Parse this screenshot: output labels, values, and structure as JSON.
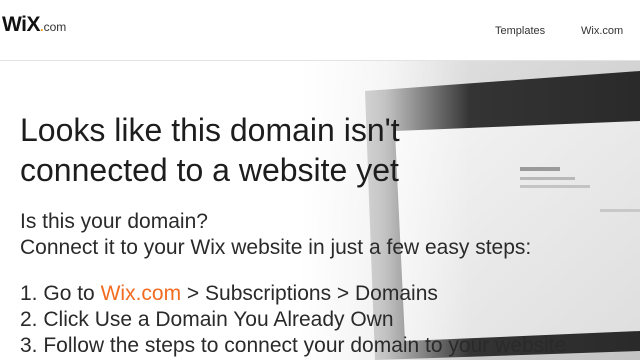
{
  "header": {
    "logo": {
      "wix": "WiX",
      "dot": ".",
      "com": "com"
    },
    "nav": [
      {
        "label": "Templates"
      },
      {
        "label": "Wix.com"
      }
    ]
  },
  "main": {
    "title_line1": "Looks like this domain isn't",
    "title_line2": "connected to a website yet",
    "question": "Is this your domain?",
    "instruction": "Connect it to your Wix website in just a few easy steps:",
    "steps": [
      {
        "number": "1.",
        "prefix": "Go to",
        "link": "Wix.com",
        "suffix": "> Subscriptions > Domains"
      },
      {
        "number": "2.",
        "text": "Click Use a Domain You Already Own"
      },
      {
        "number": "3.",
        "text": "Follow the steps to connect your domain to your website"
      }
    ]
  },
  "colors": {
    "accent": "#f26b21",
    "logo_dot": "#f7a51c",
    "text": "#1d1d1d"
  }
}
